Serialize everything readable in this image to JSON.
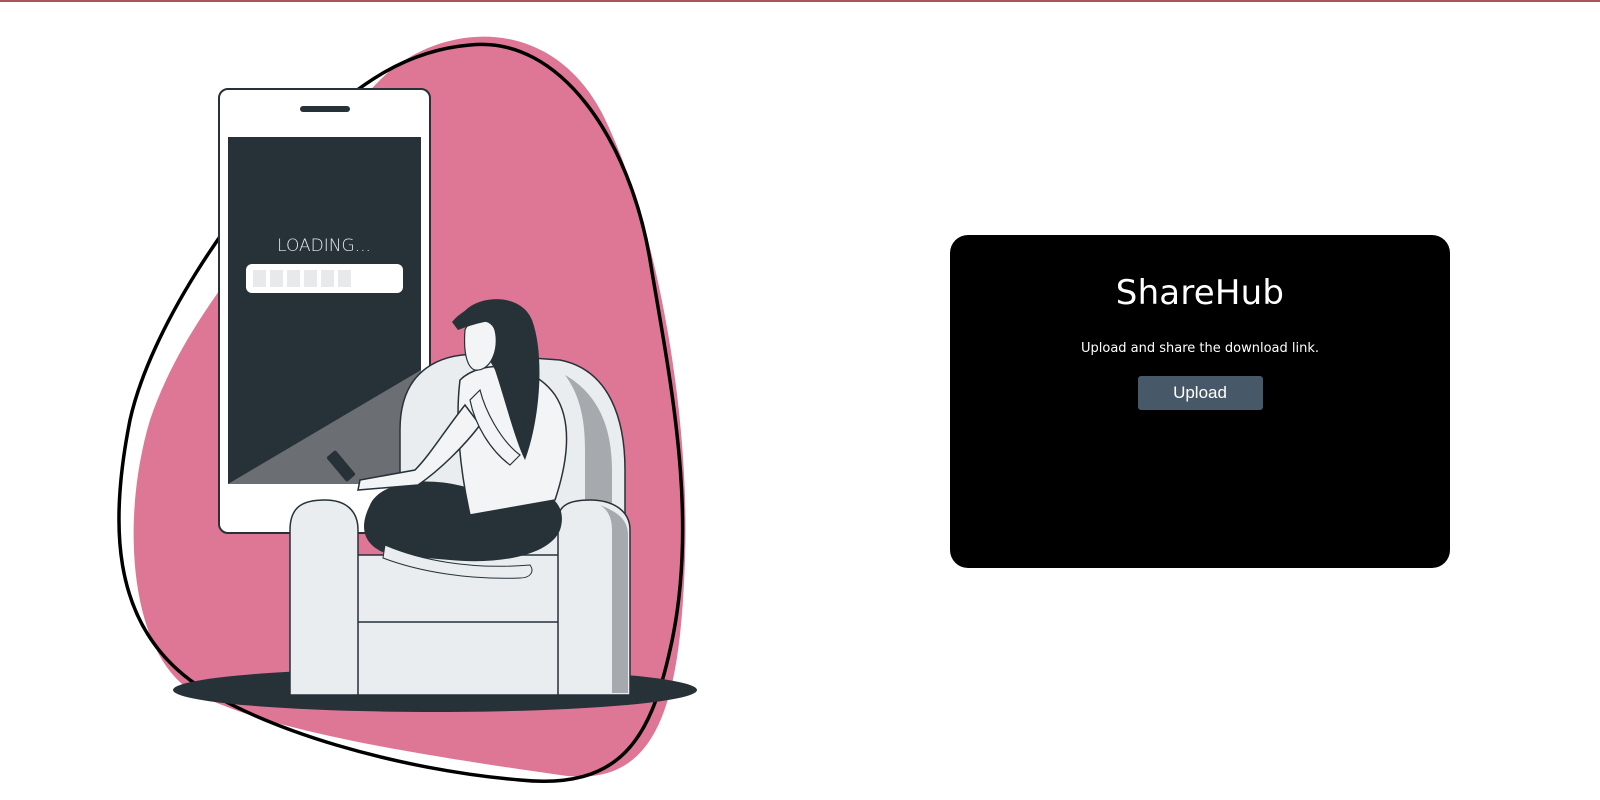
{
  "illustration": {
    "phone_screen_text": "LOADING..."
  },
  "card": {
    "title": "ShareHub",
    "subtitle": "Upload and share the download link.",
    "upload_label": "Upload"
  },
  "colors": {
    "blob": "#dd7795",
    "card_background": "#000000",
    "button_background": "#475869",
    "dark": "#263238",
    "top_rule": "#a8565c"
  }
}
